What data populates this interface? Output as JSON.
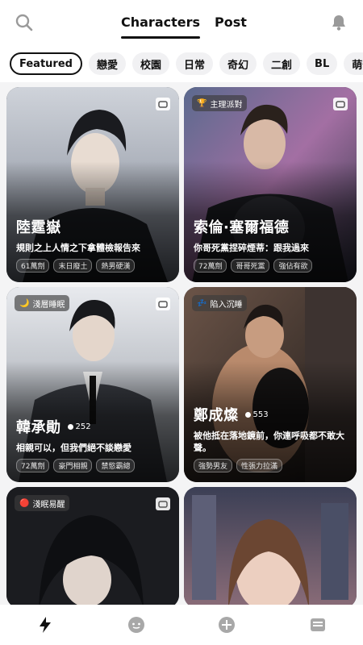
{
  "header": {
    "tabs": [
      {
        "label": "Characters",
        "active": true
      },
      {
        "label": "Post",
        "active": false
      }
    ]
  },
  "chips": [
    {
      "label": "Featured",
      "active": true
    },
    {
      "label": "戀愛"
    },
    {
      "label": "校園"
    },
    {
      "label": "日常"
    },
    {
      "label": "奇幻"
    },
    {
      "label": "二創"
    },
    {
      "label": "BL"
    },
    {
      "label": "萌寵"
    }
  ],
  "cards": [
    {
      "name": "陸霆嶽",
      "desc": "規則之上人情之下拿體檢報告來",
      "tags": [
        "61萬劑",
        "末日廢土",
        "熱男硬漢"
      ]
    },
    {
      "badge": "主理派對",
      "name": "索倫·塞爾福德",
      "desc": "你哥死黨捏碎煙蒂：跟我過來",
      "tags": [
        "72萬劑",
        "哥哥死黨",
        "強佔有欲"
      ]
    },
    {
      "badge": "淺層睡眠",
      "name": "韓承勛",
      "count": "252",
      "desc": "相親可以，但我們絕不談戀愛",
      "tags": [
        "72萬劑",
        "豪門相親",
        "禁慾霸總"
      ]
    },
    {
      "badge": "陷入沉睡",
      "name": "鄭成燦",
      "count": "553",
      "desc": "被他抵在落地鏡前，你連呼吸都不敢大聲。",
      "tags": [
        "強勢男友",
        "性張力拉滿"
      ]
    },
    {
      "badge": "淺眠易醒"
    },
    {}
  ],
  "colors": {
    "accent": "#111111",
    "background": "#f4f4f5",
    "chip_bg": "#f1f1f3"
  },
  "icons": {
    "search": "search-icon",
    "bell": "bell-icon",
    "nav": [
      "lightning-icon",
      "chat-bubble-icon",
      "plus-circle-icon",
      "inbox-icon"
    ]
  }
}
